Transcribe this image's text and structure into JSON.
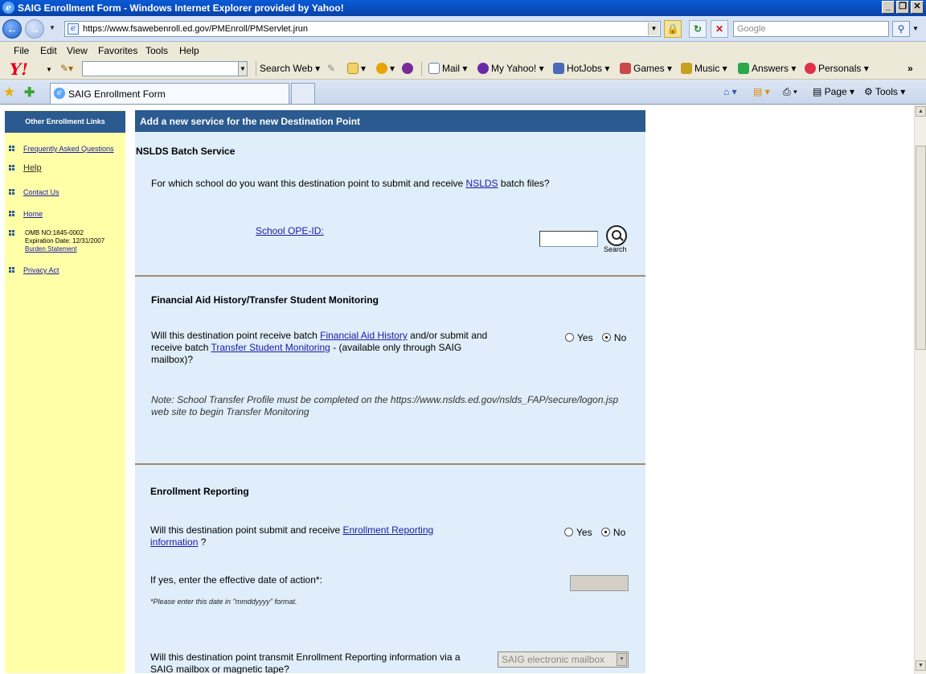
{
  "window": {
    "title": "SAIG Enrollment Form - Windows Internet Explorer provided by Yahoo!",
    "minimize": "_",
    "maximize": "❐",
    "close": "✕"
  },
  "address": {
    "url": "https://www.fsawebenroll.ed.gov/PMEnroll/PMServlet.jrun",
    "search_placeholder": "Google"
  },
  "menu": [
    "File",
    "Edit",
    "View",
    "Favorites",
    "Tools",
    "Help"
  ],
  "yahoo_toolbar": {
    "logo": "Y!",
    "search_button": "Search Web",
    "items": {
      "mail": "Mail",
      "my_yahoo": "My Yahoo!",
      "hotjobs": "HotJobs",
      "games": "Games",
      "music": "Music",
      "answers": "Answers",
      "personals": "Personals"
    },
    "more": "»"
  },
  "tabs": {
    "active_label": "SAIG Enrollment Form"
  },
  "commands": {
    "page": "Page",
    "tools": "Tools"
  },
  "sidebar": {
    "heading": "Other Enrollment Links",
    "links": {
      "faq": "Frequently Asked Questions",
      "help": "Help",
      "contact": "Contact Us",
      "home": "Home",
      "burden": "Burden Statement",
      "privacy": "Privacy Act"
    },
    "omb_line1": "OMB NO:1845-0002",
    "omb_line2": "Expiration Date:  12/31/2007"
  },
  "main": {
    "heading": "Add a new service for the new Destination Point",
    "nslds": {
      "title": "NSLDS Batch Service",
      "question_pre": "For which school do you want this destination point to submit and receive ",
      "question_link": "NSLDS",
      "question_post": " batch files?",
      "ope_label": "School OPE-ID:",
      "ope_value": "",
      "search_label": "Search"
    },
    "fah": {
      "title": "Financial Aid History/Transfer Student Monitoring",
      "q_pre": "Will this destination point receive batch ",
      "q_link1": "Financial Aid History",
      "q_mid": " and/or submit and receive batch ",
      "q_link2": "Transfer Student Monitoring",
      "q_post": " - (available only through SAIG mailbox)?",
      "yes": "Yes",
      "no": "No",
      "selected": "No",
      "note": "Note: School Transfer Profile must be completed on the https://www.nslds.ed.gov/nslds_FAP/secure/logon.jsp web site to begin Transfer Monitoring"
    },
    "enrollment": {
      "title": "Enrollment Reporting",
      "q_pre": "Will this destination point submit and receive ",
      "q_link": "Enrollment Reporting information",
      "q_post": " ?",
      "yes": "Yes",
      "no": "No",
      "selected": "No",
      "date_label": "If yes, enter the effective date of action*:",
      "date_value": "",
      "date_note": "*Please enter this date in \"mmddyyyy\" format.",
      "transmit_q": "Will this destination point transmit Enrollment Reporting information via a SAIG mailbox or magnetic tape?",
      "transmit_value": "SAIG electronic mailbox"
    }
  },
  "colors": {
    "title_blue": "#0842a8",
    "header_blue": "#2a5a8f",
    "sidebar_yellow": "#ffffa8",
    "panel_blue": "#dfeefa",
    "link": "#1a1aa6"
  }
}
